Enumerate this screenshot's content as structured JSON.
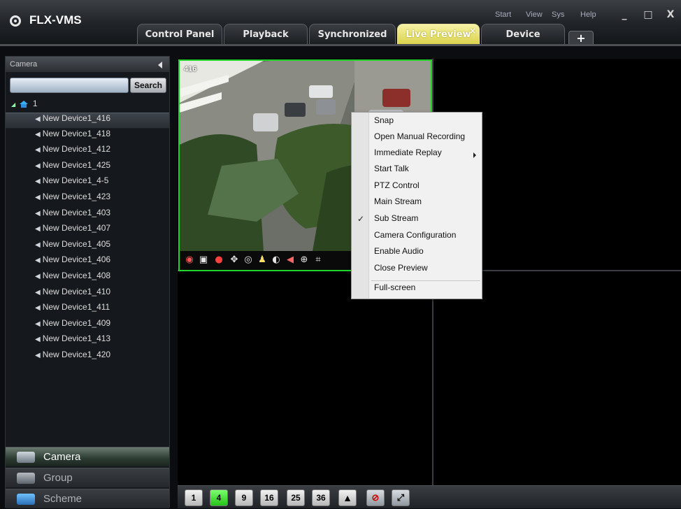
{
  "app": {
    "title": "FLX-VMS"
  },
  "top_menu": [
    "Start",
    "View",
    "Sys",
    "Help"
  ],
  "window_buttons": [
    "_",
    "□",
    "X"
  ],
  "tabs": [
    {
      "label": "Control Panel",
      "active": false
    },
    {
      "label": "Playback",
      "active": false
    },
    {
      "label": "Synchronized",
      "active": false
    },
    {
      "label": "Live Preview",
      "active": true
    },
    {
      "label": "Device",
      "active": false
    }
  ],
  "tab_close_glyph": "×",
  "tab_add_glyph": "+",
  "left_panel": {
    "header": "Camera",
    "search_button": "Search",
    "search_value": "",
    "tree_root": "1",
    "devices": [
      "New Device1_416",
      "New Device1_418",
      "New Device1_412",
      "New Device1_425",
      "New Device1_4-5",
      "New Device1_423",
      "New Device1_403",
      "New Device1_407",
      "New Device1_405",
      "New Device1_406",
      "New Device1_408",
      "New Device1_410",
      "New Device1_411",
      "New Device1_409",
      "New Device1_413",
      "New Device1_420"
    ],
    "selected_device": "New Device1_416",
    "nav": [
      {
        "label": "Camera",
        "active": true
      },
      {
        "label": "Group",
        "active": false
      },
      {
        "label": "Scheme",
        "active": false
      }
    ]
  },
  "video": {
    "label": "416"
  },
  "context_menu": [
    {
      "label": "Snap"
    },
    {
      "label": "Open Manual Recording"
    },
    {
      "label": "Immediate Replay",
      "submenu": true
    },
    {
      "label": "Start Talk"
    },
    {
      "label": "PTZ Control"
    },
    {
      "label": "Main Stream"
    },
    {
      "label": "Sub Stream",
      "checked": true
    },
    {
      "label": "Camera Configuration"
    },
    {
      "label": "Enable Audio"
    },
    {
      "label": "Close Preview"
    },
    {
      "label": "Full-screen",
      "separator_before": true
    }
  ],
  "layout_buttons": [
    "1",
    "4",
    "9",
    "16",
    "25",
    "36"
  ],
  "active_layout": "4",
  "colors": {
    "accent_green": "#22d32a",
    "active_tab": "#d9d14a"
  }
}
